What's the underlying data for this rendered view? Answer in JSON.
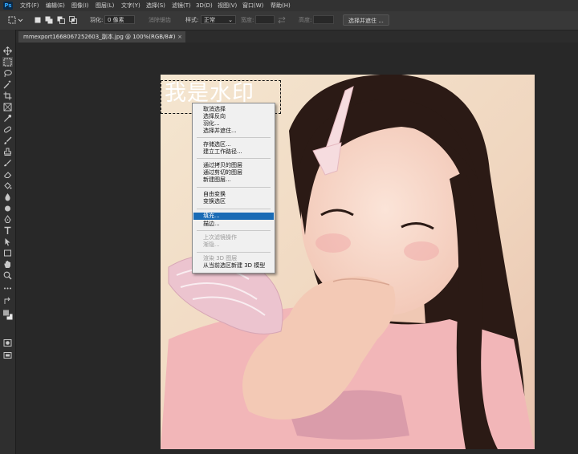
{
  "app": {
    "logo": "Ps"
  },
  "menu": [
    "文件(F)",
    "编辑(E)",
    "图像(I)",
    "图层(L)",
    "文字(Y)",
    "选择(S)",
    "滤镜(T)",
    "3D(D)",
    "视图(V)",
    "窗口(W)",
    "帮助(H)"
  ],
  "options": {
    "feather_label": "羽化:",
    "feather_value": "0 像素",
    "antialias_label": "消除锯齿",
    "style_label": "样式:",
    "style_value": "正常",
    "width_label": "宽度:",
    "height_label": "高度:",
    "select_mask_button": "选择并遮住 ..."
  },
  "document": {
    "tab_title": "mmexport1668067252603_副本.jpg @ 100%(RGB/8#)",
    "close": "×"
  },
  "watermark_text": "我是水印",
  "context_menu": {
    "groups": [
      [
        {
          "label": "取消选择",
          "enabled": true
        },
        {
          "label": "选择反向",
          "enabled": true
        },
        {
          "label": "羽化...",
          "enabled": true
        },
        {
          "label": "选择并遮住...",
          "enabled": true
        }
      ],
      [
        {
          "label": "存储选区...",
          "enabled": true
        },
        {
          "label": "建立工作路径...",
          "enabled": true
        }
      ],
      [
        {
          "label": "通过拷贝的图层",
          "enabled": true
        },
        {
          "label": "通过剪切的图层",
          "enabled": true
        },
        {
          "label": "新建图层...",
          "enabled": true
        }
      ],
      [
        {
          "label": "自由变换",
          "enabled": true
        },
        {
          "label": "变换选区",
          "enabled": true
        }
      ],
      [
        {
          "label": "填充...",
          "enabled": true,
          "active": true
        },
        {
          "label": "描边...",
          "enabled": true
        }
      ],
      [
        {
          "label": "上次滤镜操作",
          "enabled": false
        },
        {
          "label": "渐隐...",
          "enabled": false
        }
      ],
      [
        {
          "label": "渲染 3D 图层",
          "enabled": false
        },
        {
          "label": "从当前选区新建 3D 模型",
          "enabled": true
        }
      ]
    ]
  },
  "colors": {
    "accent": "#1a6bb5",
    "panel": "#383838",
    "background": "#282828",
    "menu_bg": "#f0f0f0"
  },
  "tools": [
    "move-icon",
    "marquee-icon",
    "lasso-icon",
    "magic-wand-icon",
    "crop-icon",
    "frame-icon",
    "eyedropper-icon",
    "healing-brush-icon",
    "brush-icon",
    "clone-stamp-icon",
    "history-brush-icon",
    "eraser-icon",
    "paint-bucket-icon",
    "blur-icon",
    "dodge-icon",
    "pen-icon",
    "type-icon",
    "path-selection-icon",
    "rectangle-icon",
    "hand-icon",
    "zoom-icon",
    "more-tools-icon",
    "swap-colors-icon",
    "color-swatches-icon",
    "quick-mask-icon",
    "screen-mode-icon"
  ]
}
